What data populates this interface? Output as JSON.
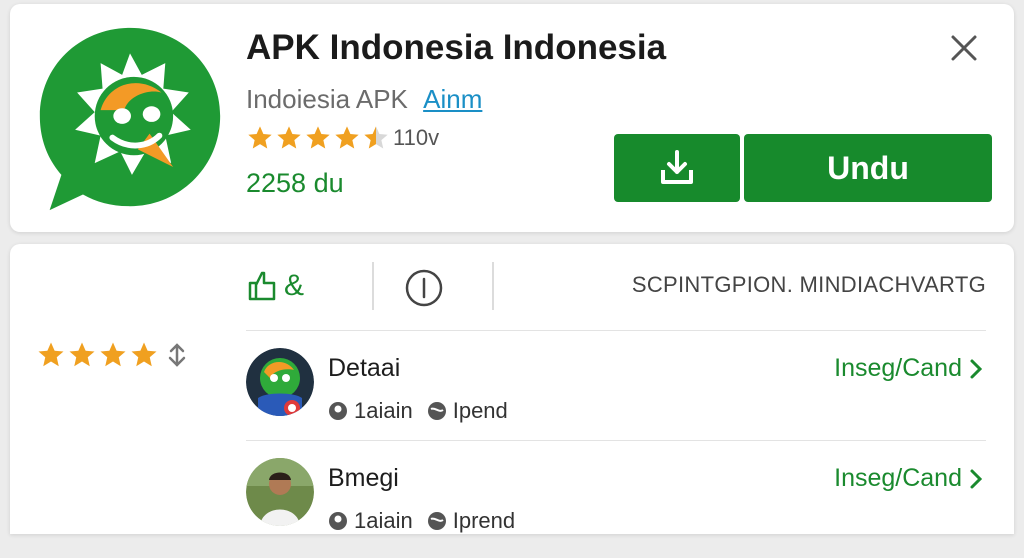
{
  "header": {
    "title": "APK Indonesia Indonesia",
    "developer": "Indoiesia APK",
    "developer_link": "Ainm",
    "rating_stars": 4.5,
    "rating_count": "110v",
    "downloads": "2258 du",
    "install_label": "Undu",
    "download_icon": "download-icon",
    "close_icon": "close-icon"
  },
  "colors": {
    "brand_green": "#178a2c",
    "star_orange": "#f0a020",
    "link_blue": "#1a8fc6"
  },
  "sidebar": {
    "rating_stars": 4
  },
  "tabs": {
    "like_label": "&",
    "description_label": "SCPINTGPION. MINDIACHVARTG"
  },
  "items": [
    {
      "title": "Detaai",
      "meta_1": "1aiain",
      "meta_2": "Ipend",
      "action": "Inseg/Cand"
    },
    {
      "title": "Bmegi",
      "meta_1": "1aiain",
      "meta_2": "Iprend",
      "action": "Inseg/Cand"
    }
  ]
}
